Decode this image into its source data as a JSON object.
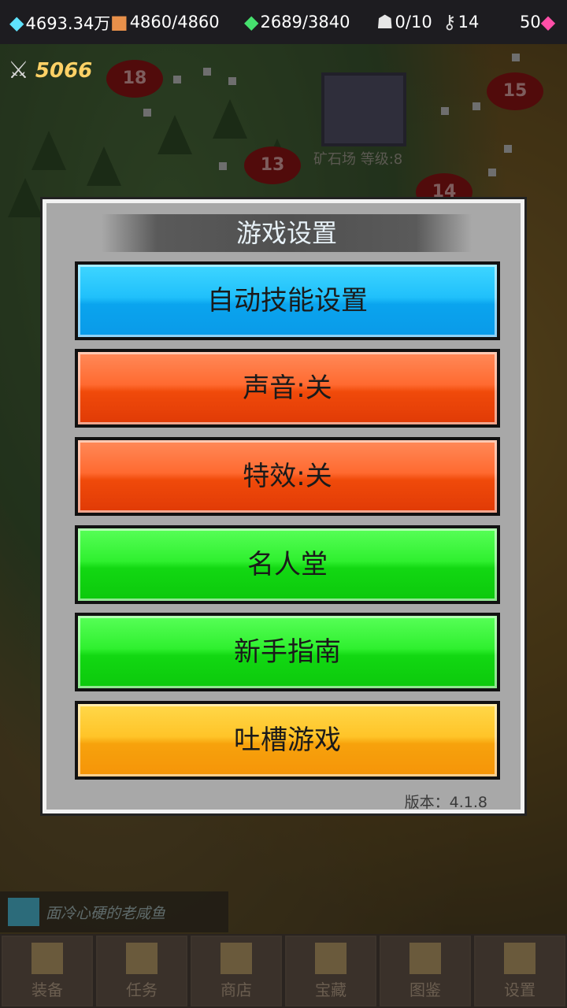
{
  "resources": [
    {
      "icon": "diamond-icon",
      "value": "4693.34万"
    },
    {
      "icon": "scroll-icon",
      "value": "4860/4860"
    },
    {
      "icon": "green-gem-icon",
      "value": "2689/3840"
    },
    {
      "icon": "ghost-icon",
      "value": "0/10"
    },
    {
      "icon": "key-icon",
      "value": "14"
    },
    {
      "icon": "pink-gem-icon",
      "value": "50"
    }
  ],
  "combat_power": "5066",
  "map": {
    "nodes": [
      "18",
      "15",
      "13",
      "14"
    ],
    "mine_label": "矿石场 等级:8"
  },
  "modal": {
    "title": "游戏设置",
    "buttons": {
      "auto_skill": "自动技能设置",
      "sound": "声音:关",
      "effects": "特效:关",
      "hall_of_fame": "名人堂",
      "guide": "新手指南",
      "feedback": "吐槽游戏"
    },
    "version": "版本：4.1.8"
  },
  "chat": {
    "text": "面冷心硬的老咸鱼"
  },
  "nav": [
    "装备",
    "任务",
    "商店",
    "宝藏",
    "图鉴",
    "设置"
  ],
  "colors": {
    "blue_button": "#20c0fb",
    "red_button": "#ff6a30",
    "green_button": "#2ff02f",
    "yellow_button": "#ffc428",
    "panel": "#a8a8a8"
  }
}
